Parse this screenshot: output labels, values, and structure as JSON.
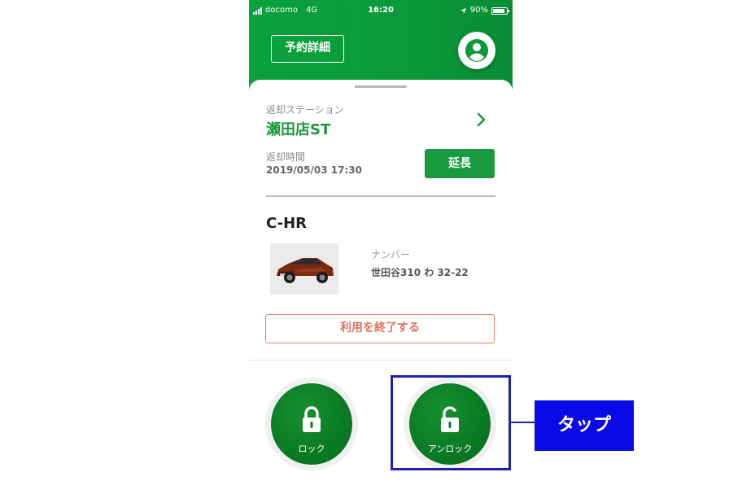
{
  "status_bar": {
    "carrier": "docomo",
    "network": "4G",
    "time": "16:20",
    "battery": "90%",
    "battery_level": 0.9
  },
  "header": {
    "detail_button": "予約詳細",
    "avatar_icon": "user-icon",
    "color": "#0aa13d"
  },
  "return": {
    "station_label": "返却ステーション",
    "station_name": "瀬田店ST",
    "time_label": "返却時間",
    "time_value": "2019/05/03 17:30",
    "extend_button": "延長"
  },
  "car": {
    "name": "C-HR",
    "plate_label": "ナンバー",
    "plate_value": "世田谷310 わ 32-22"
  },
  "end_button": "利用を終了する",
  "controls": {
    "lock_label": "ロック",
    "unlock_label": "アンロック",
    "accent": "#0a7a24"
  },
  "annotation": {
    "tap_label": "タップ",
    "color": "#0a0ae6"
  }
}
